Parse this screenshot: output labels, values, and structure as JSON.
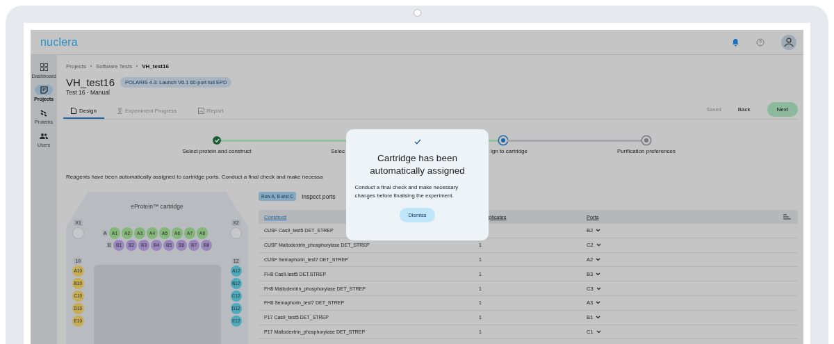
{
  "app": {
    "logo": "nuclera"
  },
  "sidebar": {
    "items": [
      {
        "label": "Dashboard",
        "selected": false
      },
      {
        "label": "Projects",
        "selected": true
      },
      {
        "label": "Proteins",
        "selected": false
      },
      {
        "label": "Users",
        "selected": false
      }
    ]
  },
  "breadcrumb": [
    "Projects",
    "Software Tests",
    "VH_test16"
  ],
  "page": {
    "title": "VH_test16",
    "badge": "POLARIS 4.3: Launch V6.1 60-port full EPD",
    "subtitle": "Test 16 - Manual"
  },
  "tabs": [
    {
      "label": "Design",
      "selected": true
    },
    {
      "label": "Experiment Progress",
      "selected": false
    },
    {
      "label": "Report",
      "selected": false
    }
  ],
  "actions": {
    "status": "Saved",
    "back": "Back",
    "next": "Next"
  },
  "steps": [
    {
      "label": "Select protein and construct",
      "completed": true,
      "active": false
    },
    {
      "label": "Selec"
    },
    {
      "label": "ign to cartridge",
      "completed": false,
      "active": true
    },
    {
      "label": "Purification preferences",
      "completed": false,
      "active": false
    }
  ],
  "intro": "Reagents have been automatically assigned to cartridge ports. Conduct a final check and make necessa",
  "cartridge": {
    "title": "eProtein™ cartridge",
    "reserve_ports": [
      "X1",
      "X2"
    ],
    "port_groups": [
      {
        "kind": "row",
        "label": "A",
        "color": "#85b77b",
        "ports": [
          "A1",
          "A2",
          "A3",
          "A4",
          "A5",
          "A6",
          "A7",
          "A8"
        ]
      },
      {
        "kind": "row",
        "label": "B",
        "color": "#9a87bd",
        "ports": [
          "B1",
          "B2",
          "B3",
          "B4",
          "B5",
          "B6",
          "B7",
          "B8"
        ]
      },
      {
        "kind": "column",
        "label": "10",
        "color": "#c7ad57",
        "ports": [
          "A10",
          "B10",
          "C10",
          "D10",
          "E10"
        ]
      },
      {
        "kind": "column",
        "label": "12",
        "color": "#4fabbc",
        "ports": [
          "A12",
          "B12",
          "C12",
          "D12",
          "E12"
        ]
      }
    ]
  },
  "table": {
    "filter_chip": "Row A, B and C",
    "filter_label": "Inspect ports",
    "columns": [
      {
        "label": "Construct",
        "sorted": true
      },
      {
        "label": "plicates",
        "sorted": false
      },
      {
        "label": "Ports",
        "sorted": false
      }
    ],
    "rows": [
      {
        "construct": "CUSF Cas9_test5 DET_STREP",
        "port": "B2"
      },
      {
        "construct": "CUSF Maltodextrin_phosphorylase DET_STREP",
        "replicates": "1",
        "port": "C2"
      },
      {
        "construct": "CUSF Semaphorin_test7 DET_STREP",
        "replicates": "1",
        "port": "A2"
      },
      {
        "construct": "FH8 Cas9.test5 DET.STREP",
        "replicates": "1",
        "port": "B3"
      },
      {
        "construct": "FH8 Maltodextrin_phosphorylase DET_STREP",
        "replicates": "1",
        "port": "C3"
      },
      {
        "construct": "FH8 Semaphorin_test7 DET_STREP",
        "replicates": "1",
        "port": "A3"
      },
      {
        "construct": "P17 Cas9_test5 DET_STREP",
        "replicates": "1",
        "port": "B1"
      },
      {
        "construct": "P17 Maltodextrin_phosphorylase DET_STREP",
        "replicates": "1",
        "port": "C1"
      }
    ]
  },
  "modal": {
    "title": "Cartridge has been automatically assigned",
    "body": "Conduct a final check and make necessary changes before finalising the experiment.",
    "button": "Dismiss"
  }
}
